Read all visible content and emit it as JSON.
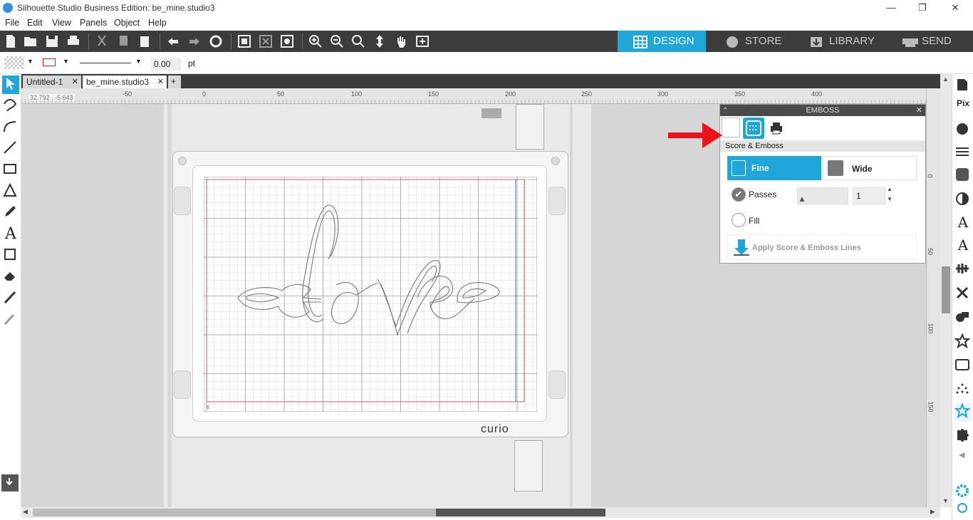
{
  "window": {
    "title": "Silhouette Studio Business Edition: be_mine.studio3",
    "minimize": "—",
    "restore": "❐",
    "close": "✕"
  },
  "menu": [
    "File",
    "Edit",
    "View",
    "Panels",
    "Object",
    "Help"
  ],
  "nav_tabs": [
    {
      "label": "DESIGN",
      "active": true
    },
    {
      "label": "STORE",
      "active": false
    },
    {
      "label": "LIBRARY",
      "active": false
    },
    {
      "label": "SEND",
      "active": false
    }
  ],
  "line_settings": {
    "width_value": "0.00",
    "unit": "pt"
  },
  "doc_tabs": [
    {
      "label": "Untitled-1",
      "active": false
    },
    {
      "label": "be_mine.studio3",
      "active": true
    }
  ],
  "new_tab": "+",
  "ruler": {
    "coords": "32.792 , -5.643",
    "h_ticks": [
      "-50",
      "0",
      "50",
      "100",
      "150",
      "200",
      "250",
      "300",
      "350",
      "400"
    ],
    "v_ticks": [
      "0",
      "50",
      "100",
      "150"
    ]
  },
  "mat": {
    "brand": "curio",
    "corner_mark": "6",
    "artwork_text": "love"
  },
  "emboss_panel": {
    "title": "EMBOSS",
    "section": "Score & Emboss",
    "fine_label": "Fine",
    "wide_label": "Wide",
    "passes_label": "Passes",
    "passes_value": "1",
    "passes_checked": true,
    "fill_label": "Fill",
    "fill_checked": false,
    "apply_label": "Apply Score & Emboss Lines"
  },
  "colors": {
    "accent": "#1ea7d8",
    "toolbar": "#3c3c3c",
    "arrow": "#e8141b",
    "grid_red": "#e0566a"
  },
  "icons": {
    "right_panel": [
      "page-setup-icon",
      "pixscan-icon",
      "fill-icon",
      "line-style-icon",
      "fill-pattern-icon",
      "gradient-icon",
      "text-style-icon",
      "text-to-path-icon",
      "align-icon",
      "replicate-icon",
      "modify-icon",
      "offset-icon",
      "trace-icon",
      "library-shape-icon",
      "sketch-icon",
      "emboss-icon",
      "puzzle-icon",
      "settings-icon"
    ]
  }
}
